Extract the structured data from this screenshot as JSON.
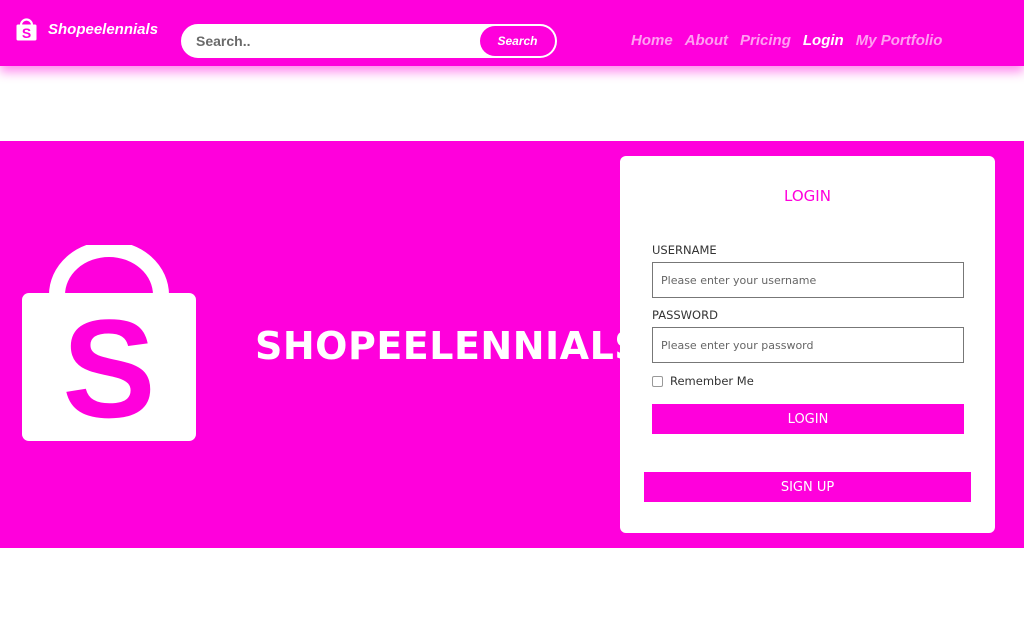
{
  "header": {
    "brand_name": "Shopeelennials",
    "search": {
      "placeholder": "Search..",
      "button_label": "Search"
    },
    "nav": [
      {
        "label": "Home",
        "active": false
      },
      {
        "label": "About",
        "active": false
      },
      {
        "label": "Pricing",
        "active": false
      },
      {
        "label": "Login",
        "active": true
      },
      {
        "label": "My Portfolio",
        "active": false
      }
    ]
  },
  "hero": {
    "title": "SHOPEELENNIALS",
    "logo_letter": "S"
  },
  "login_card": {
    "title": "LOGIN",
    "username": {
      "label": "USERNAME",
      "placeholder": "Please enter your username"
    },
    "password": {
      "label": "PASSWORD",
      "placeholder": "Please enter your password"
    },
    "remember_label": "Remember Me",
    "remember_checked": false,
    "login_button": "LOGIN",
    "signup_button": "SIGN UP"
  },
  "colors": {
    "brand": "#ff00dc",
    "text_light": "#ffffff"
  },
  "icons": {
    "brand_icon": "shopping-bag-icon",
    "hero_logo": "shopping-bag-logo-icon"
  }
}
